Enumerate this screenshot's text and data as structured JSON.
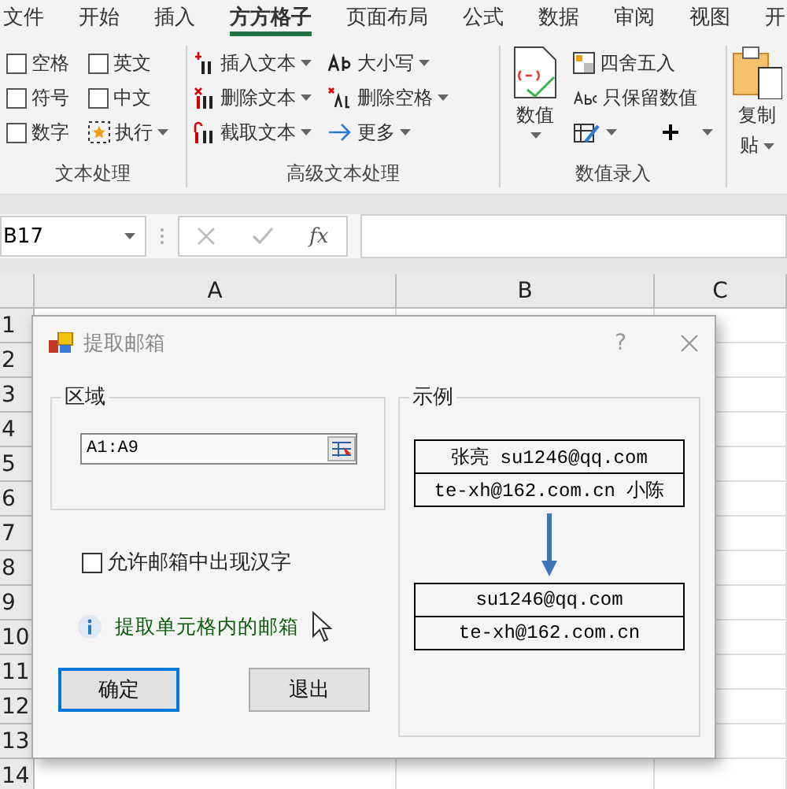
{
  "tabs": [
    {
      "label": "文件",
      "selected": false
    },
    {
      "label": "开始",
      "selected": false
    },
    {
      "label": "插入",
      "selected": false
    },
    {
      "label": "方方格子",
      "selected": true
    },
    {
      "label": "页面布局",
      "selected": false
    },
    {
      "label": "公式",
      "selected": false
    },
    {
      "label": "数据",
      "selected": false
    },
    {
      "label": "审阅",
      "selected": false
    },
    {
      "label": "视图",
      "selected": false
    },
    {
      "label": "开",
      "selected": false
    }
  ],
  "ribbon": [
    {
      "label": "文本处理",
      "kind": "checks",
      "items": [
        {
          "kind": "checkbox",
          "label": "空格",
          "checked": false
        },
        {
          "kind": "checkbox",
          "label": "符号",
          "checked": false
        },
        {
          "kind": "checkbox",
          "label": "数字",
          "checked": false
        },
        {
          "kind": "checkbox",
          "label": "英文",
          "checked": false
        },
        {
          "kind": "checkbox",
          "label": "中文",
          "checked": false
        },
        {
          "kind": "button",
          "label": "执行"
        }
      ]
    },
    {
      "label": "高级文本处理",
      "kind": "actions",
      "items": [
        {
          "label": "插入文本"
        },
        {
          "label": "删除文本"
        },
        {
          "label": "截取文本"
        },
        {
          "label": "大小写"
        },
        {
          "label": "删除空格"
        },
        {
          "label": "更多"
        }
      ]
    },
    {
      "label": "数值录入",
      "kind": "numbers",
      "large": {
        "label": "数值"
      },
      "items": [
        {
          "label": "四舍五入"
        },
        {
          "label": "只保留数值"
        }
      ]
    },
    {
      "kind": "cut",
      "large": {
        "label": "复制",
        "label_2": "贴"
      }
    }
  ],
  "formula_bar": {
    "name_box": "B17",
    "fx": "fx"
  },
  "sheet": {
    "columns": [
      "A",
      "B",
      "C"
    ],
    "rows": [
      "1",
      "2",
      "3",
      "4",
      "5",
      "6",
      "7",
      "8",
      "9",
      "10",
      "11",
      "12",
      "13",
      "14"
    ]
  },
  "dialog": {
    "title": "提取邮箱",
    "help": "?",
    "range_group": {
      "legend": "区域",
      "value": "A1:A9"
    },
    "allow_chinese": {
      "label": "允许邮箱中出现汉字",
      "checked": false
    },
    "info": "提取单元格内的邮箱",
    "buttons": [
      {
        "label": "确定",
        "default": true
      },
      {
        "label": "退出",
        "default": false
      }
    ],
    "example": {
      "legend": "示例",
      "before": [
        "张亮 su1246@qq.com",
        "te-xh@162.com.cn 小陈"
      ],
      "after": [
        "su1246@qq.com",
        "te-xh@162.com.cn"
      ]
    }
  }
}
